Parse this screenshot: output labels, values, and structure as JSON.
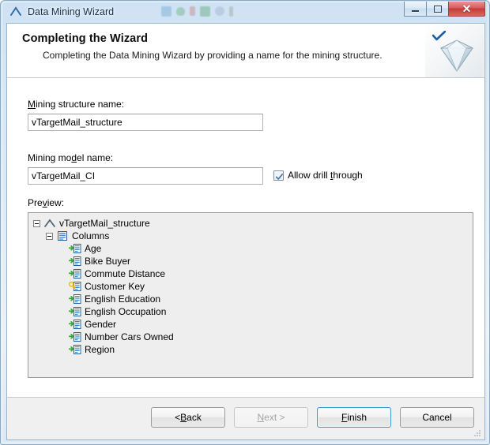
{
  "window": {
    "title": "Data Mining Wizard",
    "icon": "wizard-caret-icon",
    "controls": {
      "minimize": "Minimize",
      "maximize": "Maximize",
      "close": "Close",
      "close_glyph": "✕"
    }
  },
  "banner": {
    "title": "Completing the Wizard",
    "subtitle": "Completing the Data Mining Wizard by providing a name for the mining structure.",
    "art_icon": "diamond-gem-icon",
    "check_icon": "blue-checkmark-icon"
  },
  "form": {
    "structure_label_pre": "M",
    "structure_label_post": "ining structure name:",
    "structure_value": "vTargetMail_structure",
    "structure_placeholder": "",
    "model_label_pre": "Mining mo",
    "model_label_mn": "d",
    "model_label_post": "el name:",
    "model_value": "vTargetMail_CI",
    "model_placeholder": "",
    "drill_pre": "Allow drill ",
    "drill_mn": "t",
    "drill_post": "hrough",
    "drill_checked": true,
    "preview_pre": "Pre",
    "preview_mn": "v",
    "preview_post": "iew:"
  },
  "tree": {
    "root": {
      "label": "vTargetMail_structure",
      "icon": "mining-structure-icon",
      "expanded": true
    },
    "columns_group": {
      "label": "Columns",
      "icon": "columns-folder-icon",
      "expanded": true
    },
    "columns": [
      {
        "label": "Age",
        "icon": "column-input-icon"
      },
      {
        "label": "Bike Buyer",
        "icon": "column-input-icon"
      },
      {
        "label": "Commute Distance",
        "icon": "column-input-icon"
      },
      {
        "label": "Customer Key",
        "icon": "column-key-icon"
      },
      {
        "label": "English Education",
        "icon": "column-input-icon"
      },
      {
        "label": "English Occupation",
        "icon": "column-input-icon"
      },
      {
        "label": "Gender",
        "icon": "column-input-icon"
      },
      {
        "label": "Number Cars Owned",
        "icon": "column-input-icon"
      },
      {
        "label": "Region",
        "icon": "column-input-icon"
      }
    ]
  },
  "footer": {
    "back_pre": "< ",
    "back_mn": "B",
    "back_post": "ack",
    "next_mn": "N",
    "next_post": "ext >",
    "finish_mn": "F",
    "finish_post": "inish",
    "cancel": "Cancel",
    "next_disabled": true,
    "finish_is_default": true
  },
  "colors": {
    "accent_blue": "#3c9ad6",
    "title_text": "#1b2f49",
    "close_red": "#c23a3a",
    "key_yellow": "#e8c020",
    "arrow_green": "#3f9b3f",
    "panel_gray": "#eeeeee",
    "footer_gray": "#f0f0f0"
  }
}
